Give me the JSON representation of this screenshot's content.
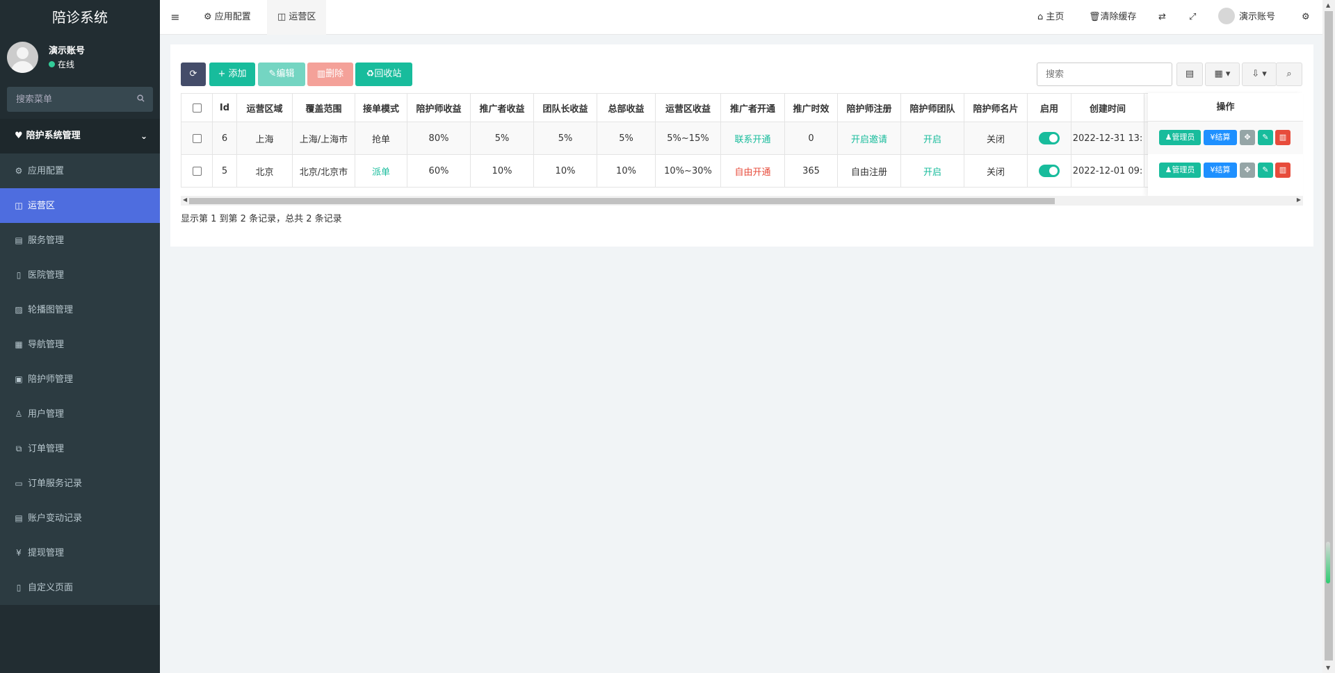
{
  "app": {
    "title": "陪诊系统"
  },
  "user": {
    "name": "演示账号",
    "status": "在线"
  },
  "sidebar": {
    "search_placeholder": "搜索菜单",
    "group": {
      "label": "陪护系统管理"
    },
    "items": [
      {
        "label": "应用配置",
        "icon": "gear-icon"
      },
      {
        "label": "运营区",
        "icon": "map-icon"
      },
      {
        "label": "服务管理",
        "icon": "list-icon"
      },
      {
        "label": "医院管理",
        "icon": "hospital-icon"
      },
      {
        "label": "轮播图管理",
        "icon": "image-icon"
      },
      {
        "label": "导航管理",
        "icon": "table-icon"
      },
      {
        "label": "陪护师管理",
        "icon": "id-card-icon"
      },
      {
        "label": "用户管理",
        "icon": "user-icon"
      },
      {
        "label": "订单管理",
        "icon": "clipboard-icon"
      },
      {
        "label": "订单服务记录",
        "icon": "save-icon"
      },
      {
        "label": "账户变动记录",
        "icon": "list-icon"
      },
      {
        "label": "提现管理",
        "icon": "yen-icon"
      },
      {
        "label": "自定义页面",
        "icon": "file-icon"
      }
    ],
    "active_index": 1
  },
  "topbar": {
    "tabs": [
      {
        "label": "应用配置",
        "icon": "gear-icon"
      },
      {
        "label": "运营区",
        "icon": "map-icon"
      }
    ],
    "right": {
      "home": "主页",
      "clear_cache": "清除缓存",
      "account": "演示账号"
    }
  },
  "toolbar": {
    "add": "添加",
    "edit": "编辑",
    "delete": "删除",
    "recycle": "回收站",
    "search_placeholder": "搜索"
  },
  "table": {
    "columns": [
      "Id",
      "运营区域",
      "覆盖范围",
      "接单模式",
      "陪护师收益",
      "推广者收益",
      "团队长收益",
      "总部收益",
      "运营区收益",
      "推广者开通",
      "推广时效",
      "陪护师注册",
      "陪护师团队",
      "陪护师名片",
      "启用",
      "创建时间"
    ],
    "rows": [
      {
        "id": "6",
        "region": "上海",
        "coverage": "上海/上海市",
        "mode": "抢单",
        "escort_income": "80%",
        "promoter_income": "5%",
        "leader_income": "5%",
        "hq_income": "5%",
        "zone_income": "5%~15%",
        "promoter_open": "联系开通",
        "promo_period": "0",
        "escort_register": "开启邀请",
        "escort_team": "开启",
        "escort_card": "关闭",
        "enabled": true,
        "created": "2022-12-31 13:"
      },
      {
        "id": "5",
        "region": "北京",
        "coverage": "北京/北京市",
        "mode": "派单",
        "escort_income": "60%",
        "promoter_income": "10%",
        "leader_income": "10%",
        "hq_income": "10%",
        "zone_income": "10%~30%",
        "promoter_open": "自由开通",
        "promo_period": "365",
        "escort_register": "自由注册",
        "escort_team": "开启",
        "escort_card": "关闭",
        "enabled": true,
        "created": "2022-12-01 09:"
      }
    ],
    "ops_header": "操作",
    "ops": {
      "admin": "管理员",
      "settle": "结算"
    }
  },
  "pagination": {
    "info": "显示第 1 到第 2 条记录，总共 2 条记录"
  },
  "colors": {
    "sidebar_bg": "#222d32",
    "active": "#4e6ddf",
    "success": "#18bc9c",
    "danger": "#e74c3c",
    "primary": "#1e90ff"
  }
}
